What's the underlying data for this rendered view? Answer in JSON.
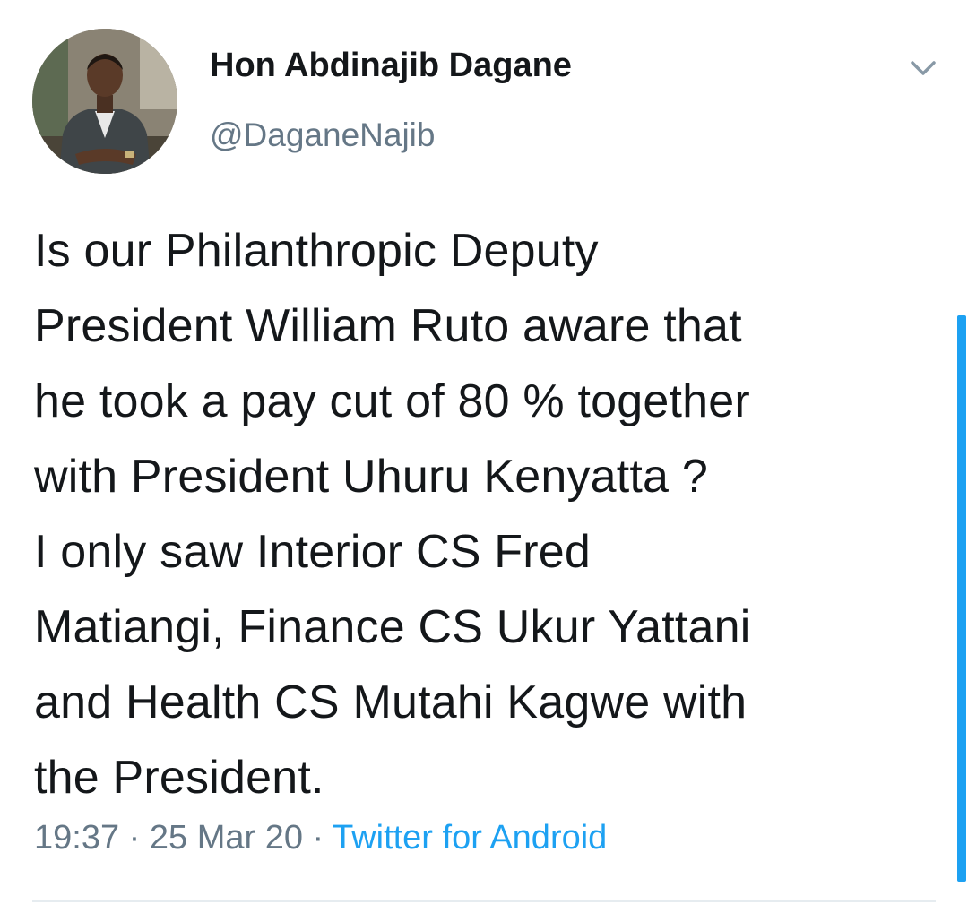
{
  "author": {
    "name": "Hon Abdinajib Dagane",
    "handle": "@DaganeNajib"
  },
  "tweet": {
    "lines": [
      "Is our Philanthropic Deputy",
      "President William Ruto aware that",
      "he took a pay cut of 80 % together",
      "with President Uhuru Kenyatta ?",
      "I only saw Interior CS Fred",
      "Matiangi, Finance CS Ukur Yattani",
      "and Health CS Mutahi Kagwe with",
      "the President."
    ],
    "time": "19:37",
    "separator": " · ",
    "date": "25 Mar 20",
    "source": "Twitter for Android"
  },
  "icons": {
    "menu": "chevron-down-icon",
    "avatar": "profile-photo"
  },
  "colors": {
    "text": "#14171a",
    "secondary": "#657786",
    "accent": "#1da1f2",
    "divider": "#e6ecf0"
  }
}
